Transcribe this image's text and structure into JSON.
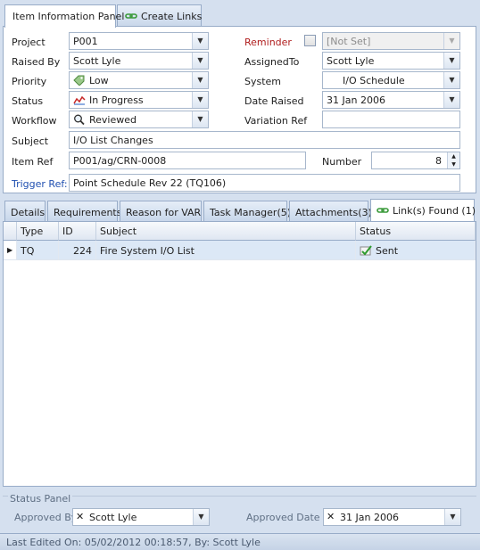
{
  "tabs": {
    "info": "Item Information Panel",
    "links": "Create Links"
  },
  "form": {
    "project": {
      "label": "Project",
      "value": "P001"
    },
    "raised_by": {
      "label": "Raised By",
      "value": "Scott Lyle"
    },
    "priority": {
      "label": "Priority",
      "value": "Low"
    },
    "status": {
      "label": "Status",
      "value": "In Progress"
    },
    "workflow": {
      "label": "Workflow",
      "value": "Reviewed"
    },
    "subject": {
      "label": "Subject",
      "value": "I/O List Changes"
    },
    "item_ref": {
      "label": "Item Ref",
      "value": "P001/ag/CRN-0008"
    },
    "trigger_ref": {
      "label": "Trigger Ref:",
      "value": "Point Schedule Rev 22 (TQ106)"
    },
    "reminder": {
      "label": "Reminder",
      "value": "[Not Set]"
    },
    "assigned_to": {
      "label": "AssignedTo",
      "value": "Scott Lyle"
    },
    "system": {
      "label": "System",
      "value": "I/O Schedule"
    },
    "date_raised": {
      "label": "Date Raised",
      "value": "31 Jan 2006"
    },
    "variation_ref": {
      "label": "Variation Ref",
      "value": ""
    },
    "number": {
      "label": "Number",
      "value": "8"
    }
  },
  "lower_tabs": [
    "Details",
    "Requirements",
    "Reason for VAR",
    "Task Manager(5)",
    "Attachments(3)",
    "Link(s) Found (1)"
  ],
  "grid": {
    "columns": [
      "Type",
      "ID",
      "Subject",
      "Status"
    ],
    "rows": [
      {
        "type": "TQ",
        "id": "224",
        "subject": "Fire System I/O List",
        "status": "Sent"
      }
    ]
  },
  "status_panel": {
    "title": "Status Panel",
    "approved_by_label": "Approved By",
    "approved_by": "Scott Lyle",
    "approved_date_label": "Approved Date",
    "approved_date": "31 Jan 2006"
  },
  "footer": "Last Edited On: 05/02/2012 00:18:57, By: Scott Lyle",
  "colors": {
    "accent": "#98acc8",
    "link_label": "#1f4fb0",
    "reminder_label": "#b01e1e",
    "background": "#d5e0ef"
  },
  "icons": [
    "chain-link-icon",
    "tag-icon",
    "progress-graph-icon",
    "magnifier-icon",
    "sent-check-icon",
    "row-pointer-icon",
    "clear-x-icon",
    "chevron-down-icon",
    "spin-up-icon",
    "spin-down-icon"
  ]
}
